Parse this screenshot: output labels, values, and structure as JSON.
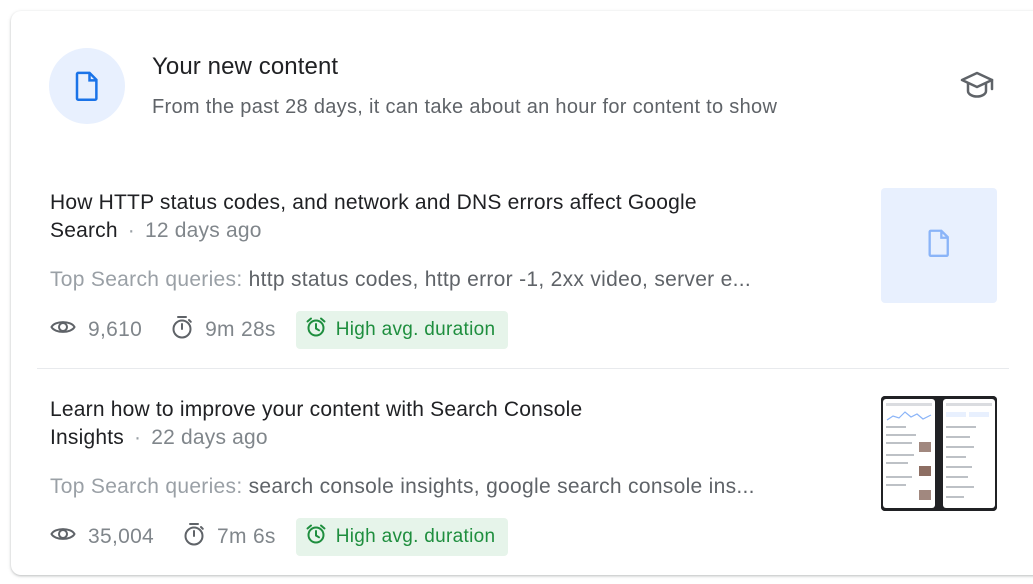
{
  "header": {
    "title": "Your new content",
    "subtitle": "From the past 28 days, it can take about an hour for content to show"
  },
  "items": [
    {
      "title": "How HTTP status codes, and network and DNS errors affect Google Search",
      "age": "12 days ago",
      "queries_label": "Top Search queries:",
      "queries": "http status codes, http error -1, 2xx video, server e...",
      "views": "9,610",
      "duration": "9m 28s",
      "badge": "High avg. duration"
    },
    {
      "title": "Learn how to improve your content with Search Console Insights",
      "age": "22 days ago",
      "queries_label": "Top Search queries:",
      "queries": "search console insights, google search console ins...",
      "views": "35,004",
      "duration": "7m 6s",
      "badge": "High avg. duration"
    }
  ],
  "colors": {
    "accent": "#4285f4",
    "badge_bg": "#e6f4ea",
    "badge_text": "#1e8e3e"
  }
}
